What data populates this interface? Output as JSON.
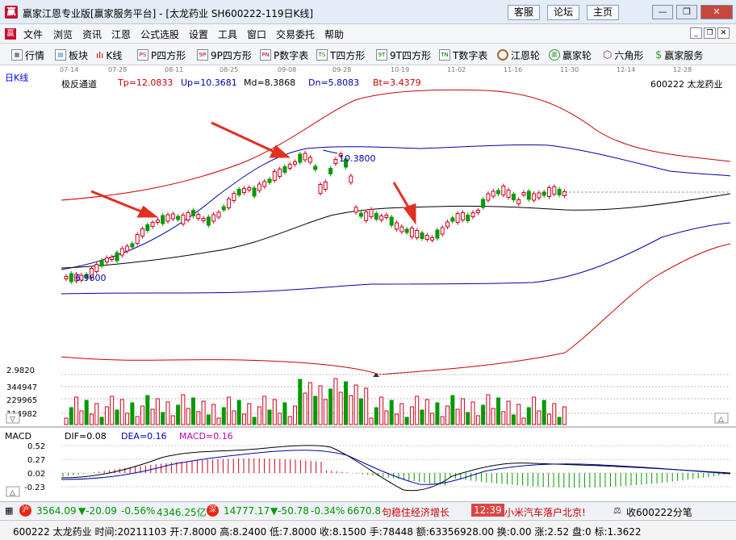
{
  "window": {
    "title": "赢家江恩专业版[赢家服务平台] - [太龙药业  SH600222-119日K线]",
    "buttons": [
      "客服",
      "论坛",
      "主页"
    ],
    "controls": {
      "minimize": "—",
      "restore": "❐",
      "close": "✕"
    }
  },
  "menu": [
    "文件",
    "浏览",
    "资讯",
    "江恩",
    "公式选股",
    "设置",
    "工具",
    "窗口",
    "交易委托",
    "帮助"
  ],
  "toolbar": [
    {
      "label": "行情",
      "icon": "grid-icon"
    },
    {
      "label": "板块",
      "icon": "blocks-icon"
    },
    {
      "label": "K线",
      "icon": "candles-icon"
    },
    {
      "label": "P四方形",
      "icon": "ps-icon",
      "tag": "PS"
    },
    {
      "label": "9P四方形",
      "icon": "9p-icon",
      "tag": "9P"
    },
    {
      "label": "P数字表",
      "icon": "pn-icon",
      "tag": "PN"
    },
    {
      "label": "T四方形",
      "icon": "ts-icon",
      "tag": "TS"
    },
    {
      "label": "9T四方形",
      "icon": "9t-icon",
      "tag": "9T"
    },
    {
      "label": "T数字表",
      "icon": "tn-icon",
      "tag": "TN"
    },
    {
      "label": "江恩轮",
      "icon": "wheel-icon"
    },
    {
      "label": "赢家轮",
      "icon": "winner-wheel-icon",
      "tag": "赢"
    },
    {
      "label": "六角形",
      "icon": "hexagon-icon"
    },
    {
      "label": "赢家服务",
      "icon": "service-icon"
    }
  ],
  "chart": {
    "period_label": "日K线",
    "dates": [
      "07-14",
      "07-28",
      "08-11",
      "08-25",
      "09-08",
      "09-28",
      "10-19",
      "11-02",
      "11-16",
      "11-30",
      "12-14",
      "12-28"
    ],
    "indicator_name": "极反通道",
    "tp": "Tp=12.0833",
    "up": "Up=10.3681",
    "md": "Md=8.3868",
    "dn": "Dn=5.8083",
    "bt": "Bt=3.4379",
    "stock": "600222  太龙药业",
    "high_mark": "10.3800",
    "low_mark": "6.9600",
    "vol_scale": [
      "2.9820",
      "344947",
      "229965",
      "114982"
    ],
    "macd_title": "MACD",
    "dif": "DIF=0.08",
    "dea": "DEA=0.16",
    "macd": "MACD=0.16",
    "macd_scale": [
      "0.52",
      "0.27",
      "0.02",
      "-0.23"
    ],
    "colors": {
      "up": "#d0021b",
      "down": "#009a00",
      "upper_band": "#cc0000",
      "mid_band": "#0000aa",
      "md_band": "#000000"
    }
  },
  "ticker": {
    "sh": "3564.09",
    "sh_change": "▼-20.09",
    "sh_pct": "-0.56%",
    "sh_amount": "4346.25亿",
    "sz": "14777.17",
    "sz_change": "▼-50.78",
    "sz_pct": "-0.34%",
    "sz_amount": "6670.8",
    "news1": "句稳住经济增长",
    "time": "12:39",
    "news2": "小米汽车落户北京!",
    "action": "收600222分笔"
  },
  "quote": "600222 太龙药业 时间:20211103 开:7.8000 高:8.2400 低:7.8000 收:8.1500 手:78448 额:63356928.00 换:0.00 涨:2.52 盘:0 标:1.3622"
}
